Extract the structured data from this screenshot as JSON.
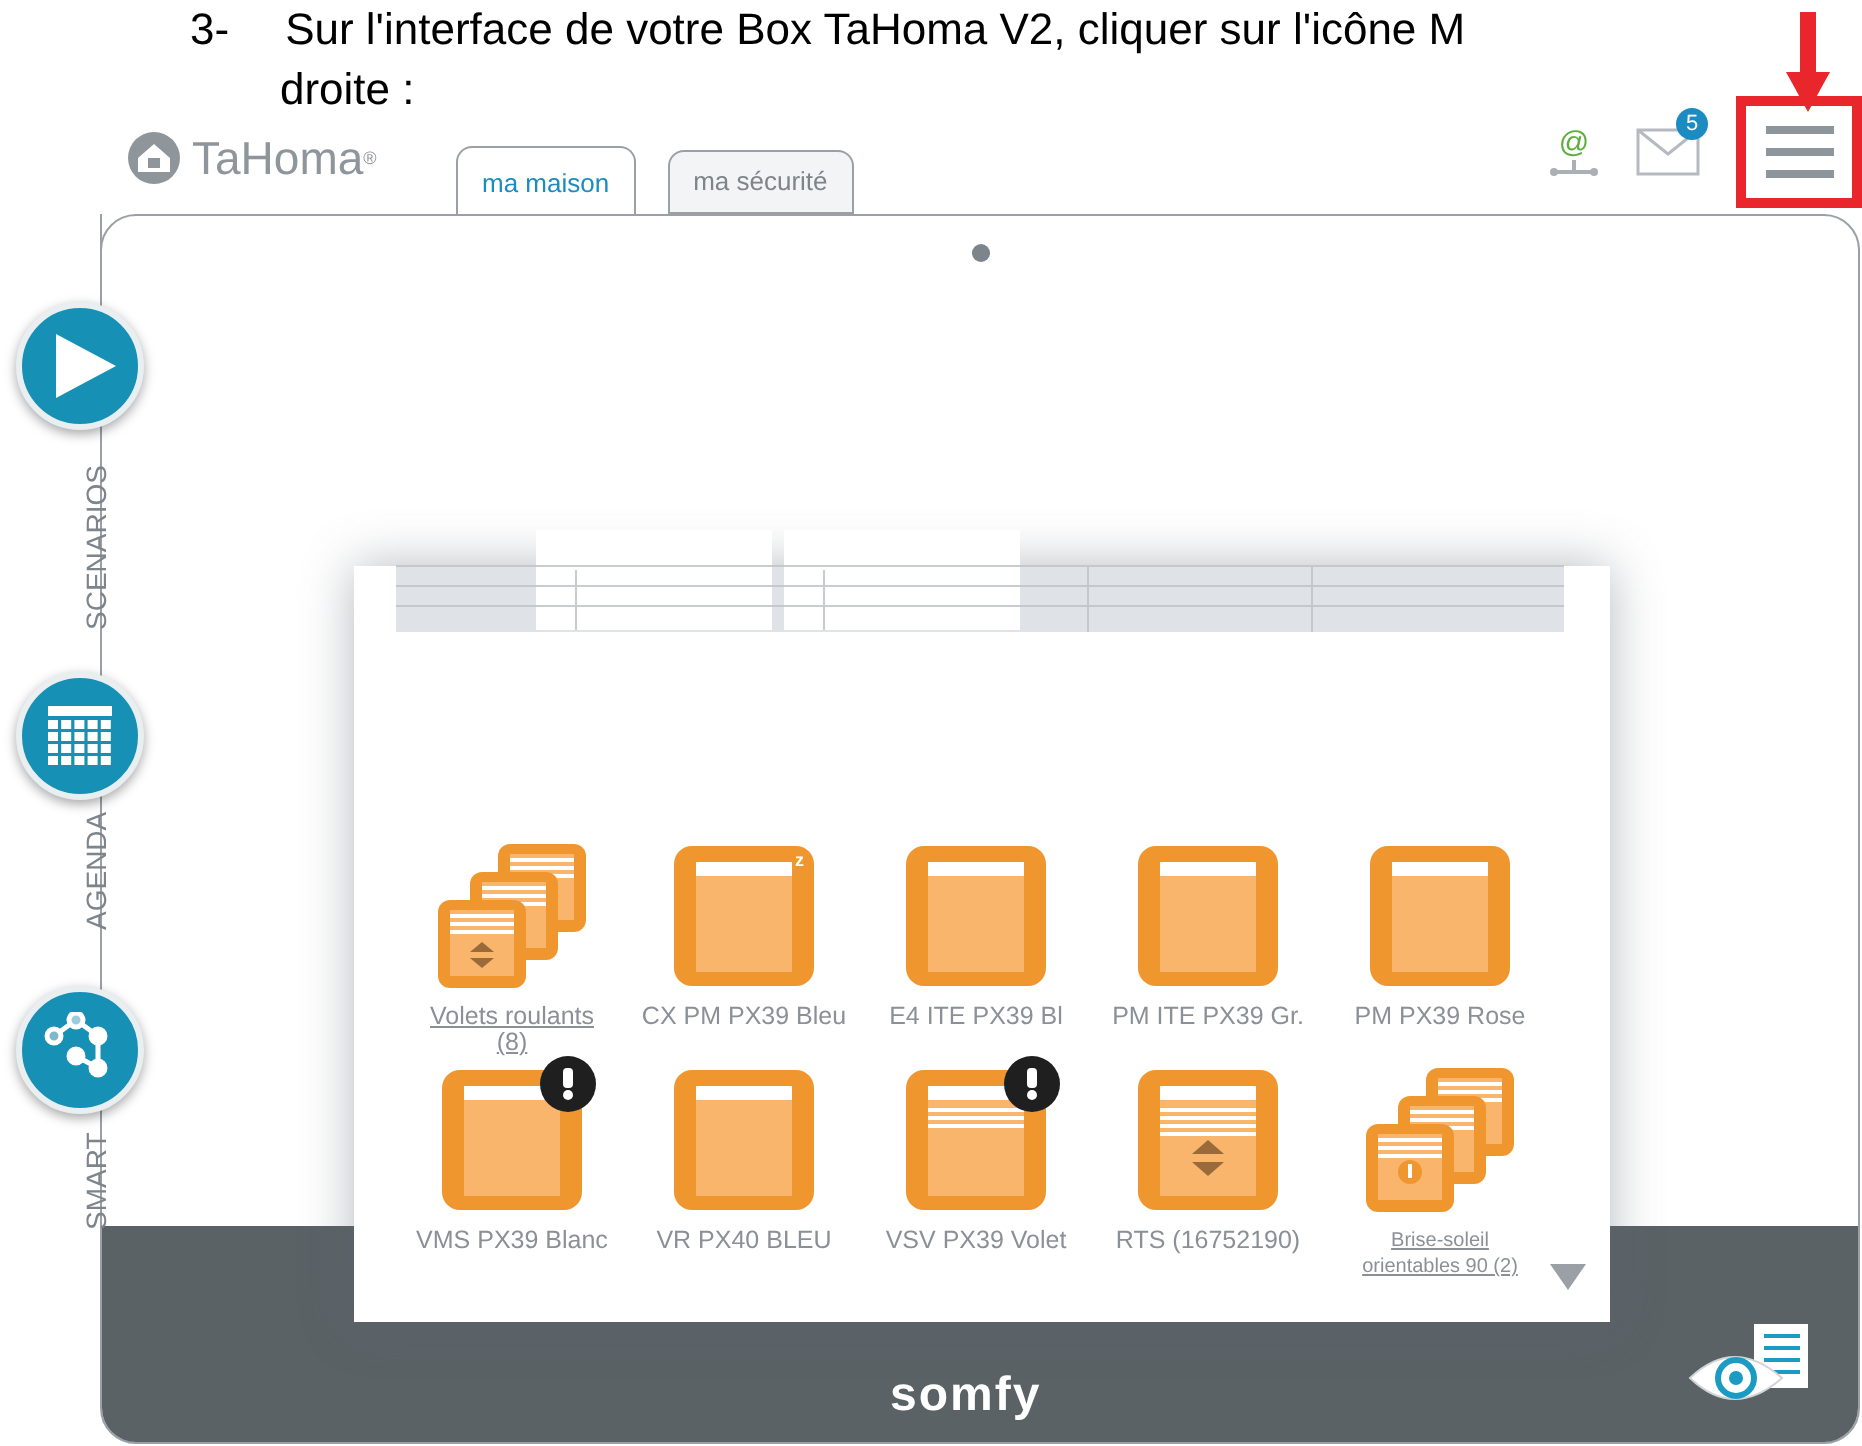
{
  "instruction": {
    "number": "3-",
    "line_1": "Sur l'interface de votre Box TaHoma V2, cliquer sur l'icône M",
    "line_2": "droite :"
  },
  "app": {
    "logo_text": "TaHoma",
    "logo_mark": "®",
    "tabs": [
      {
        "label": "ma maison",
        "selected": true
      },
      {
        "label": "ma sécurité",
        "selected": false
      }
    ],
    "connection_symbol": "@",
    "message_count": "5",
    "rail": [
      {
        "label": "SCENARIOS",
        "kind": "play"
      },
      {
        "label": "AGENDA",
        "kind": "calendar"
      },
      {
        "label": "SMART",
        "kind": "network"
      }
    ],
    "devices": [
      {
        "name": "Volets roulants (8)",
        "kind": "stack",
        "warning": false
      },
      {
        "name": "CX PM PX39 Bleu",
        "kind": "shutter",
        "badge": "z",
        "warning": false
      },
      {
        "name": "E4 ITE PX39 Bl",
        "kind": "shutter",
        "warning": false
      },
      {
        "name": "PM ITE PX39 Gr.",
        "kind": "shutter",
        "warning": false
      },
      {
        "name": "PM PX39 Rose",
        "kind": "shutter",
        "warning": false
      },
      {
        "name": "VMS PX39 Blanc",
        "kind": "shutter",
        "warning": true
      },
      {
        "name": "VR PX40 BLEU",
        "kind": "shutter",
        "warning": false
      },
      {
        "name": "VSV PX39 Volet",
        "kind": "venetian",
        "warning": true
      },
      {
        "name": "RTS (16752190)",
        "kind": "rts",
        "warning": false
      },
      {
        "name": "Brise-soleil orientables 90 (2)",
        "kind": "louver_stack",
        "warning": false
      }
    ],
    "footer_brand": "somfy"
  }
}
